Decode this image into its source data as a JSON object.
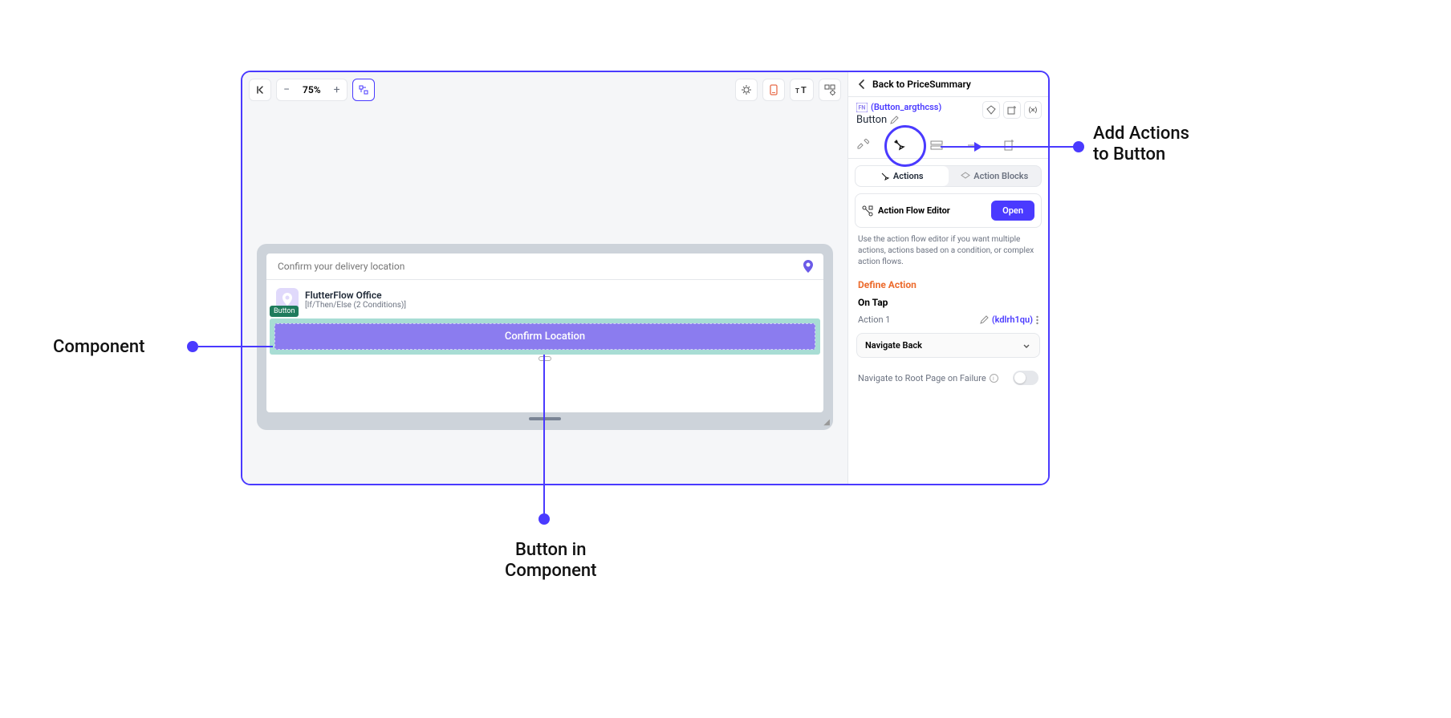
{
  "toolbar": {
    "zoom_level": "75%"
  },
  "canvas": {
    "search_placeholder": "Confirm your delivery location",
    "list_item_title": "FlutterFlow Office",
    "list_item_subtitle": "[If/Then/Else (2 Conditions)]",
    "selected_badge": "Button",
    "confirm_button_label": "Confirm Location"
  },
  "panel": {
    "back_label": "Back to PriceSummary",
    "widget_id": "(Button_argthcss)",
    "widget_type": "Button",
    "tabs": {
      "actions": "Actions",
      "action_blocks": "Action Blocks"
    },
    "afe_title": "Action Flow Editor",
    "open_button": "Open",
    "help_text": "Use the action flow editor if you want multiple actions, actions based on a condition, or complex action flows.",
    "define_action": "Define Action",
    "on_tap": "On Tap",
    "action_1": "Action 1",
    "action_link": "(kdlrh1qu)",
    "select_value": "Navigate Back",
    "toggle_label": "Navigate to Root Page on Failure"
  },
  "annotations": {
    "component": "Component",
    "button_in_component_l1": "Button in",
    "button_in_component_l2": "Component",
    "add_actions_l1": "Add Actions",
    "add_actions_l2": "to Button"
  }
}
